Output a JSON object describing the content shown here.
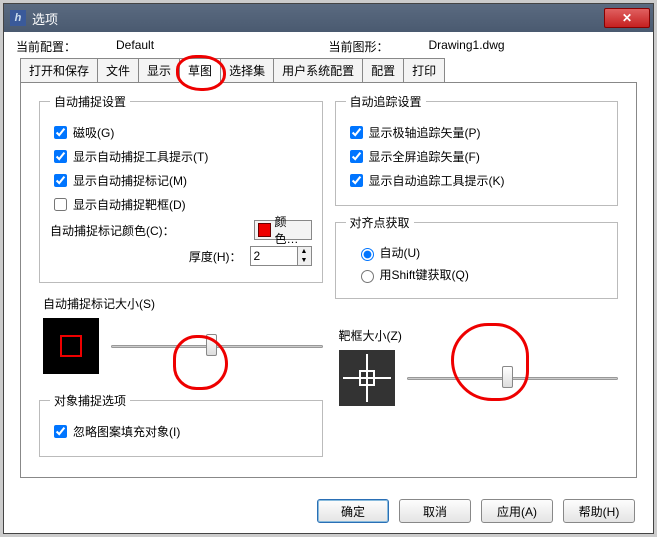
{
  "window": {
    "title": "选项"
  },
  "info": {
    "current_config_label": "当前配置：",
    "current_config_value": "Default",
    "current_drawing_label": "当前图形：",
    "current_drawing_value": "Drawing1.dwg"
  },
  "tabs": [
    "打开和保存",
    "文件",
    "显示",
    "草图",
    "选择集",
    "用户系统配置",
    "配置",
    "打印"
  ],
  "left": {
    "autosnap_legend": "自动捕捉设置",
    "magnet": "磁吸(G)",
    "tooltip": "显示自动捕捉工具提示(T)",
    "marker": "显示自动捕捉标记(M)",
    "aperture": "显示自动捕捉靶框(D)",
    "color_label": "自动捕捉标记颜色(C)：",
    "color_btn": "颜色…",
    "thickness_label": "厚度(H)：",
    "thickness_value": "2",
    "size_legend": "自动捕捉标记大小(S)",
    "objsnap_legend": "对象捕捉选项",
    "ignore_hatch": "忽略图案填充对象(I)"
  },
  "right": {
    "autotrack_legend": "自动追踪设置",
    "polar_vector": "显示极轴追踪矢量(P)",
    "full_vector": "显示全屏追踪矢量(F)",
    "track_tooltip": "显示自动追踪工具提示(K)",
    "align_legend": "对齐点获取",
    "auto": "自动(U)",
    "shift": "用Shift键获取(Q)",
    "box_legend": "靶框大小(Z)"
  },
  "buttons": {
    "ok": "确定",
    "cancel": "取消",
    "apply": "应用(A)",
    "help": "帮助(H)"
  }
}
